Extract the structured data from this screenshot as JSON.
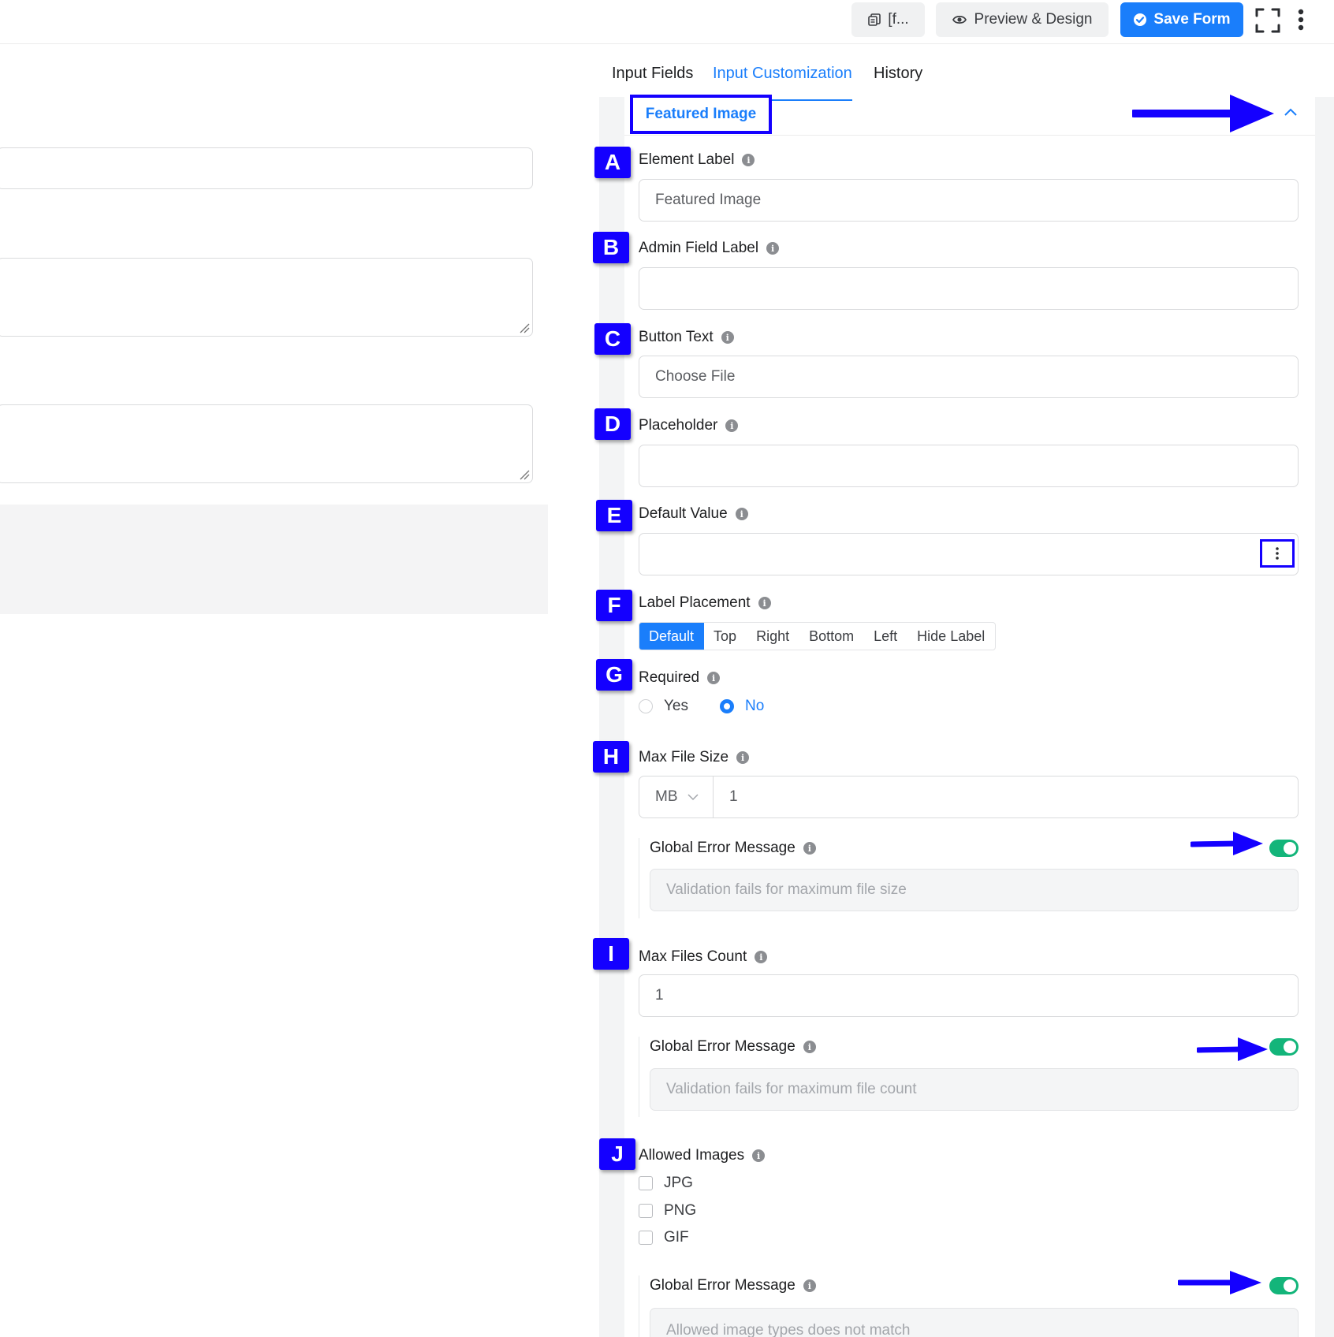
{
  "topbar": {
    "shortcode_label": "[f...",
    "preview_label": "Preview & Design",
    "save_label": "Save Form"
  },
  "tabs": [
    {
      "label": "Input Fields",
      "active": false
    },
    {
      "label": "Input Customization",
      "active": true
    },
    {
      "label": "History",
      "active": false
    }
  ],
  "section": {
    "title": "Featured Image"
  },
  "annotations": [
    "A",
    "B",
    "C",
    "D",
    "E",
    "F",
    "G",
    "H",
    "I",
    "J"
  ],
  "fields": {
    "element_label": {
      "label": "Element Label",
      "value": "Featured Image"
    },
    "admin_label": {
      "label": "Admin Field Label",
      "value": ""
    },
    "button_text": {
      "label": "Button Text",
      "value": "Choose File"
    },
    "placeholder": {
      "label": "Placeholder",
      "value": ""
    },
    "default_value": {
      "label": "Default Value",
      "value": ""
    },
    "label_placement": {
      "label": "Label Placement",
      "options": [
        "Default",
        "Top",
        "Right",
        "Bottom",
        "Left",
        "Hide Label"
      ],
      "selected": "Default"
    },
    "required": {
      "label": "Required",
      "options": [
        "Yes",
        "No"
      ],
      "selected": "No"
    },
    "max_file_size": {
      "label": "Max File Size",
      "unit": "MB",
      "value": "1"
    },
    "max_file_size_error": {
      "label": "Global Error Message",
      "placeholder": "Validation fails for maximum file size",
      "enabled": true
    },
    "max_files_count": {
      "label": "Max Files Count",
      "value": "1"
    },
    "max_files_count_error": {
      "label": "Global Error Message",
      "placeholder": "Validation fails for maximum file count",
      "enabled": true
    },
    "allowed_images": {
      "label": "Allowed Images",
      "options": [
        "JPG",
        "PNG",
        "GIF"
      ]
    },
    "allowed_images_error": {
      "label": "Global Error Message",
      "placeholder": "Allowed image types does not match",
      "enabled": true
    }
  },
  "colors": {
    "accent": "#1a7efb",
    "annotation": "#1400ff",
    "toggle_on": "#13b57a"
  }
}
